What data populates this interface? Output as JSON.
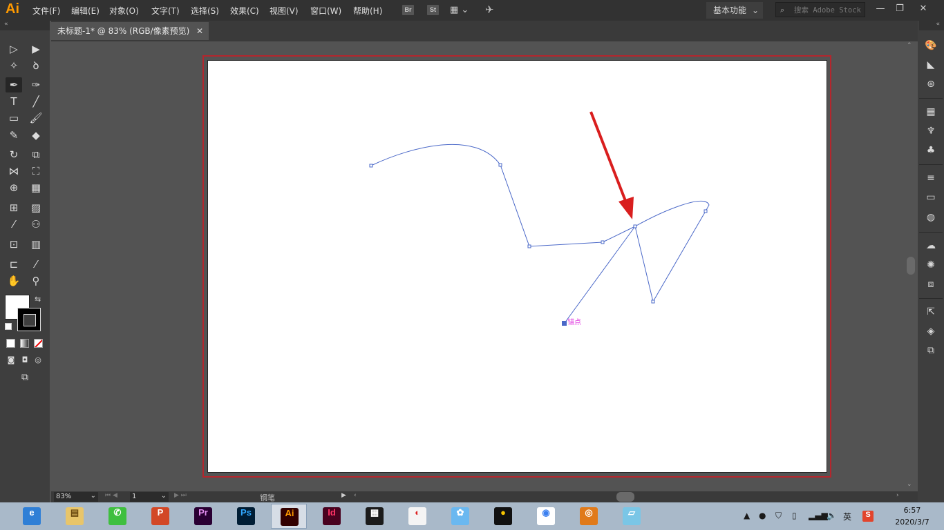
{
  "app": {
    "logo": "Ai"
  },
  "menu": [
    "文件(F)",
    "编辑(E)",
    "对象(O)",
    "文字(T)",
    "选择(S)",
    "效果(C)",
    "视图(V)",
    "窗口(W)",
    "帮助(H)"
  ],
  "toolbar": {
    "br": "Br",
    "st": "St"
  },
  "workspace": {
    "label": "基本功能"
  },
  "search": {
    "placeholder": "搜索 Adobe Stock"
  },
  "window_controls": {
    "minimize": "—",
    "restore": "❐",
    "close": "✕"
  },
  "document_tab": {
    "title": "未标题-1* @ 83% (RGB/像素预览)",
    "close": "✕"
  },
  "canvas": {
    "anchor_hint": "锚点"
  },
  "status": {
    "zoom": "83%",
    "page": "1",
    "tool": "钢笔"
  },
  "taskbar": {
    "apps": [
      {
        "name": "browser",
        "label": "e",
        "bg": "#2f7fd6",
        "fg": "#ffffff"
      },
      {
        "name": "file-explorer",
        "label": "▤",
        "bg": "#e8c56a",
        "fg": "#6b4a10"
      },
      {
        "name": "wechat",
        "label": "✆",
        "bg": "#3fbf3f",
        "fg": "#ffffff"
      },
      {
        "name": "powerpoint",
        "label": "P",
        "bg": "#d24726",
        "fg": "#ffffff"
      },
      {
        "name": "premiere",
        "label": "Pr",
        "bg": "#2a0033",
        "fg": "#e48ef0"
      },
      {
        "name": "photoshop",
        "label": "Ps",
        "bg": "#001d34",
        "fg": "#31a8ff"
      },
      {
        "name": "illustrator",
        "label": "Ai",
        "bg": "#330000",
        "fg": "#ff9a00"
      },
      {
        "name": "indesign",
        "label": "Id",
        "bg": "#49021f",
        "fg": "#ff3366"
      },
      {
        "name": "video-editor",
        "label": "▦",
        "bg": "#1b1b1b",
        "fg": "#ffffff"
      },
      {
        "name": "ball-app",
        "label": "◐",
        "bg": "#f4f4f4",
        "fg": "#d22"
      },
      {
        "name": "bird-app",
        "label": "✿",
        "bg": "#6ab8f0",
        "fg": "#ffffff"
      },
      {
        "name": "qq",
        "label": "●",
        "bg": "#111111",
        "fg": "#f5c400"
      },
      {
        "name": "chrome",
        "label": "◉",
        "bg": "#ffffff",
        "fg": "#3a7ff0"
      },
      {
        "name": "fox-app",
        "label": "◎",
        "bg": "#e07a1a",
        "fg": "#ffffff"
      },
      {
        "name": "notes-app",
        "label": "▱",
        "bg": "#7ac6e6",
        "fg": "#ffffff"
      }
    ],
    "lang": "英",
    "time": "6:57",
    "date": "2020/3/7"
  }
}
